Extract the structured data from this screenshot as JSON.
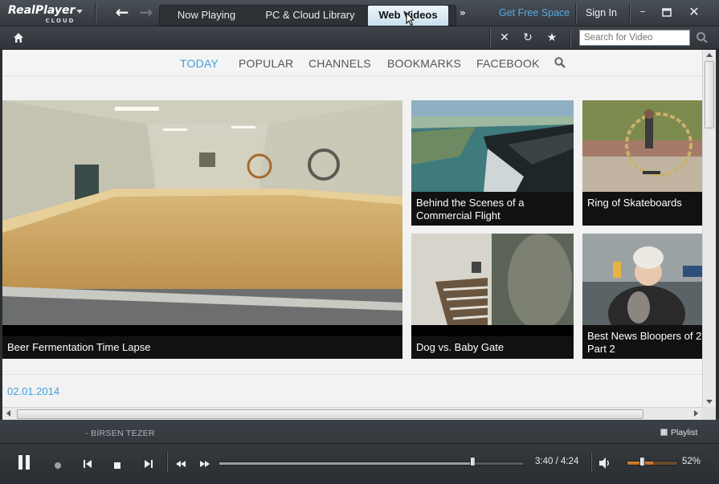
{
  "app": {
    "logo_text": "RealPlayer",
    "logo_sub": "CLOUD"
  },
  "titlebar": {
    "tabs": [
      {
        "label": "Now Playing",
        "active": false
      },
      {
        "label": "PC & Cloud Library",
        "active": false
      },
      {
        "label": "Web Videos",
        "active": true
      }
    ],
    "more_label": "»",
    "free_space_link": "Get Free Space",
    "sign_in": "Sign In"
  },
  "toolbar": {
    "search_placeholder": "Search for Video",
    "icons": [
      "home-icon",
      "close-icon",
      "refresh-icon",
      "star-icon",
      "search-icon"
    ]
  },
  "web_nav": {
    "items": [
      {
        "label": "TODAY",
        "active": true
      },
      {
        "label": "POPULAR",
        "active": false
      },
      {
        "label": "CHANNELS",
        "active": false
      },
      {
        "label": "BOOKMARKS",
        "active": false
      },
      {
        "label": "FACEBOOK",
        "active": false
      }
    ]
  },
  "videos": [
    {
      "title": "Beer Fermentation Time Lapse"
    },
    {
      "title": "Behind the Scenes of a Commercial Flight"
    },
    {
      "title": "Ring of Skateboards"
    },
    {
      "title": "Dog vs. Baby Gate"
    },
    {
      "title": "Best News Bloopers of 2 Part 2"
    }
  ],
  "date_label": "02.01.2014",
  "player": {
    "artist": "- BİRSEN TEZER",
    "playlist_label": "Playlist",
    "time": "3:40 / 4:24",
    "progress_fraction": 0.833,
    "volume_pct": "52%",
    "volume_fraction": 0.52
  },
  "colors": {
    "accent_blue": "#3ea0dc",
    "link_blue": "#54a9e3",
    "active_tab": "#c9dfec",
    "volume_orange": "#e08a3a"
  }
}
